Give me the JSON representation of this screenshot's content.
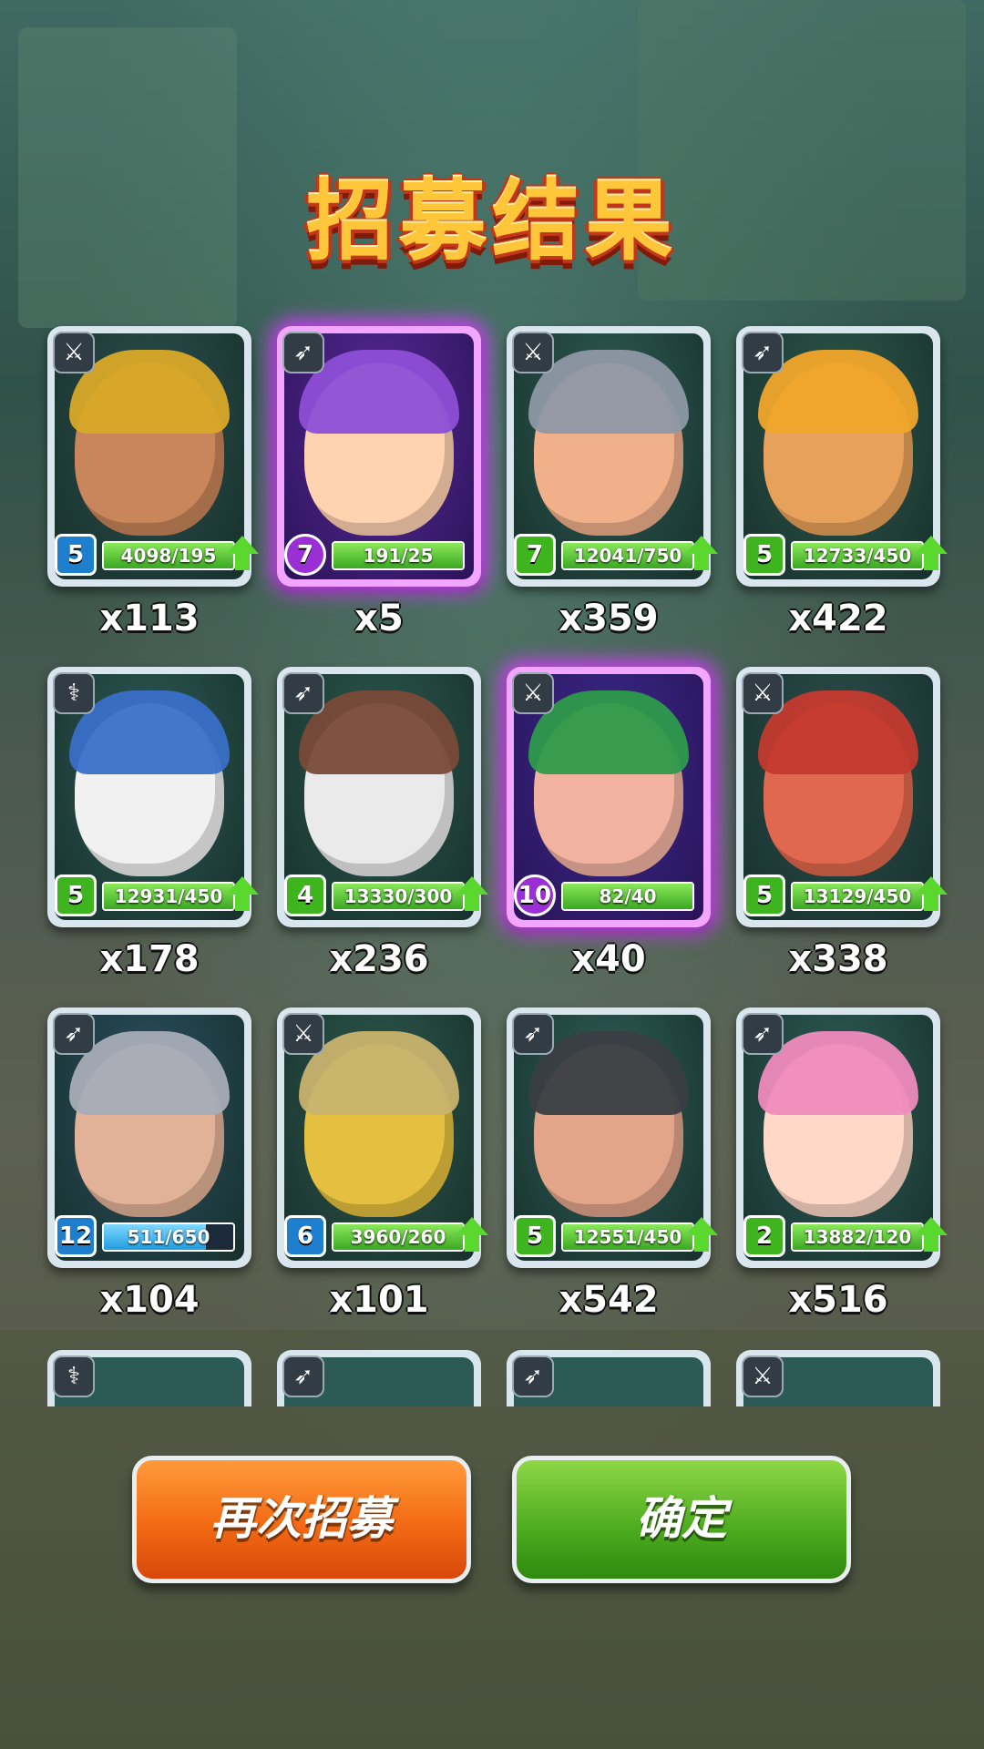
{
  "title": "招募结果",
  "colors": {
    "title_fill": "#ffc63a",
    "title_outline": "#c2361a",
    "card_frame": "#d9e6ee",
    "rare_frame": "#d63cff",
    "progress_green": "#3aa822",
    "progress_blue": "#1f9ce0",
    "button_orange": "#f26a14",
    "button_green": "#4fae20"
  },
  "heroes": [
    {
      "role_icon": "sword-icon",
      "level": "5",
      "level_style": "blue",
      "progress_text": "4098/195",
      "progress_fraction": 1.0,
      "can_upgrade": true,
      "count": "x113",
      "rarity": "normal",
      "portrait": "golden-helmet-warrior"
    },
    {
      "role_icon": "crossbow-icon",
      "level": "7",
      "level_style": "purple",
      "progress_text": "191/25",
      "progress_fraction": 1.0,
      "can_upgrade": false,
      "count": "x5",
      "rarity": "purple",
      "portrait": "purple-hair-girl"
    },
    {
      "role_icon": "sword-icon",
      "level": "7",
      "level_style": "green",
      "progress_text": "12041/750",
      "progress_fraction": 1.0,
      "can_upgrade": true,
      "count": "x359",
      "rarity": "normal",
      "portrait": "grinning-knight"
    },
    {
      "role_icon": "crossbow-icon",
      "level": "5",
      "level_style": "green",
      "progress_text": "12733/450",
      "progress_fraction": 1.0,
      "can_upgrade": true,
      "count": "x422",
      "rarity": "normal",
      "portrait": "yellow-bird-hood"
    },
    {
      "role_icon": "staff-icon",
      "level": "5",
      "level_style": "green",
      "progress_text": "12931/450",
      "progress_fraction": 1.0,
      "can_upgrade": true,
      "count": "x178",
      "rarity": "normal",
      "portrait": "blue-hood-bomber"
    },
    {
      "role_icon": "crossbow-icon",
      "level": "4",
      "level_style": "green",
      "progress_text": "13330/300",
      "progress_fraction": 1.0,
      "can_upgrade": true,
      "count": "x236",
      "rarity": "normal",
      "portrait": "bearded-gnome"
    },
    {
      "role_icon": "sword-icon",
      "level": "10",
      "level_style": "purple",
      "progress_text": "82/40",
      "progress_fraction": 1.0,
      "can_upgrade": false,
      "count": "x40",
      "rarity": "purple",
      "portrait": "green-cap-general"
    },
    {
      "role_icon": "sword-icon",
      "level": "5",
      "level_style": "green",
      "progress_text": "13129/450",
      "progress_fraction": 1.0,
      "can_upgrade": true,
      "count": "x338",
      "rarity": "normal",
      "portrait": "red-warrior"
    },
    {
      "role_icon": "crossbow-icon",
      "level": "12",
      "level_style": "blue",
      "progress_text": "511/650",
      "progress_fraction": 0.786,
      "can_upgrade": false,
      "count": "x104",
      "rarity": "normal",
      "portrait": "steel-helmet-gunner"
    },
    {
      "role_icon": "sword-icon",
      "level": "6",
      "level_style": "blue",
      "progress_text": "3960/260",
      "progress_fraction": 1.0,
      "can_upgrade": true,
      "count": "x101",
      "rarity": "normal",
      "portrait": "masked-soldier"
    },
    {
      "role_icon": "crossbow-icon",
      "level": "5",
      "level_style": "green",
      "progress_text": "12551/450",
      "progress_fraction": 1.0,
      "can_upgrade": true,
      "count": "x542",
      "rarity": "normal",
      "portrait": "samurai-goggles"
    },
    {
      "role_icon": "crossbow-icon",
      "level": "2",
      "level_style": "green",
      "progress_text": "13882/120",
      "progress_fraction": 1.0,
      "can_upgrade": true,
      "count": "x516",
      "rarity": "normal",
      "portrait": "pink-hair-girl"
    }
  ],
  "partial_row_icons": [
    "staff-icon",
    "crossbow-icon",
    "crossbow-icon",
    "sword-icon"
  ],
  "buttons": {
    "recruit_again": "再次招募",
    "confirm": "确定"
  }
}
